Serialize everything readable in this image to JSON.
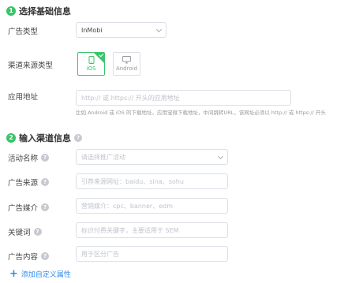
{
  "section1": {
    "number": "1",
    "title": "选择基础信息",
    "ad_type": {
      "label": "广告类型",
      "value": "InMobi"
    },
    "channel_type": {
      "label": "渠道来源类型",
      "options": [
        {
          "label": "iOS",
          "selected": true
        },
        {
          "label": "Android",
          "selected": false
        }
      ]
    },
    "app_url": {
      "label": "应用地址",
      "placeholder": "http:// 或 https:// 开头的应用地址",
      "hint": "比如 Android 或 iOS 的下载地址，应用宝微下载地址，中间跳转URL，该网址必须以 http:// 或 https:// 开头"
    }
  },
  "section2": {
    "number": "2",
    "title": "输入渠道信息",
    "campaign": {
      "label": "活动名称",
      "placeholder": "请选择推广活动"
    },
    "source": {
      "label": "广告来源",
      "placeholder": "引荐来源网址：baidu、sina、sohu"
    },
    "medium": {
      "label": "广告媒介",
      "placeholder": "营销媒介：cpc、banner、edm"
    },
    "keyword": {
      "label": "关键词",
      "placeholder": "标识付费关键字，主要适用于 SEM"
    },
    "content": {
      "label": "广告内容",
      "placeholder": "用于区分广告"
    }
  },
  "add_custom": {
    "label": "添加自定义属性"
  },
  "colors": {
    "accent": "#3ac46a",
    "link": "#2d8cf0"
  }
}
